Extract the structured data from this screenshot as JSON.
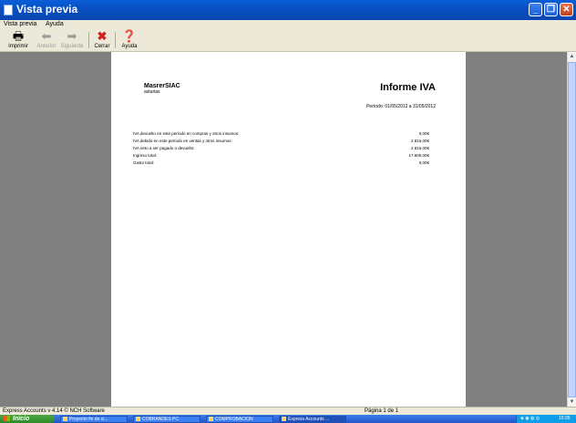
{
  "window": {
    "title": "Vista previa"
  },
  "menu": {
    "items": [
      "Vista previa",
      "Ayuda"
    ]
  },
  "toolbar": {
    "print_label": "Imprimir",
    "prev_label": "Anterior",
    "next_label": "Siguiente",
    "close_label": "Cerrar",
    "help_label": "Ayuda"
  },
  "report": {
    "company_name": "MasrerSIAC",
    "company_sub": "asturias",
    "title": "Informe IVA",
    "period": "Período: 01/05/2012 a 31/05/2012",
    "rows": [
      {
        "label": "IVA devuelto en este período en compras y otros insumos:",
        "value": "0,00€"
      },
      {
        "label": "IVA debido en este período en ventas y otros insumos:",
        "value": "2.816,00€"
      },
      {
        "label": "IVA neto a ser pagado o devuelto:",
        "value": "2.816,00€"
      },
      {
        "label": "Ingreso total:",
        "value": "17.600,00€"
      },
      {
        "label": "Gasto total:",
        "value": "0,00€"
      }
    ]
  },
  "status": {
    "left": "Express Accounts v 4.14 © NCH Software",
    "page": "Página 1 de 1"
  },
  "taskbar": {
    "start_label": "Inicio",
    "tasks": [
      "Proyecto fin de ci...",
      "COBRANDES PC",
      "COMPROBACION",
      "Express Accounts ..."
    ],
    "clock": "15:05"
  },
  "colors": {
    "titlebar": "#0a5fd8",
    "close": "#c1401a",
    "paper_bg": "#808080",
    "taskbar": "#2456c8"
  }
}
